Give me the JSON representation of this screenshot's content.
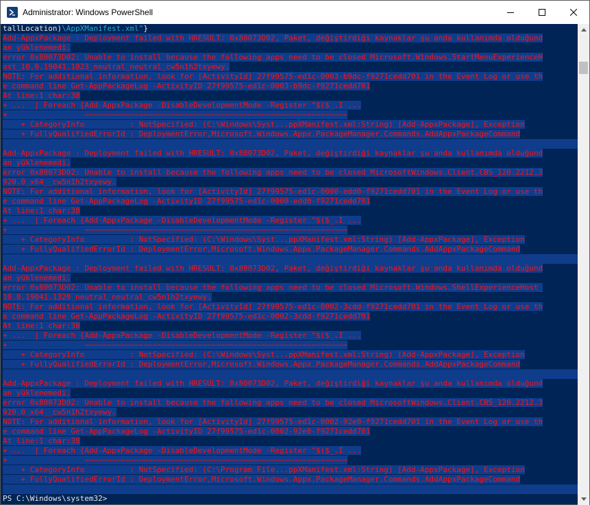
{
  "window": {
    "title": "Administrator: Windows PowerShell",
    "icon": "powershell-icon",
    "controls": [
      "minimize-icon",
      "maximize-icon",
      "close-icon"
    ]
  },
  "console": {
    "first_line": {
      "a": "tallLocation)",
      "b": "\\AppXManifest.xml\"",
      "c": "}"
    },
    "blocks": [
      {
        "lines": [
          "Add-AppxPackage : Deployment failed with HRESULT: 0x80073D02, Paket, değiştirdiği kaynaklar şu anda kullanımda olduğund",
          "an yüklenemedi.",
          "error 0x80073D02: Unable to install because the following apps need to be closed Microsoft.Windows.StartMenuExperienceH",
          "ost_10.0.19041.1023_neutral_neutral_cw5n1h2txyewy.",
          "NOTE: For additional information, look for [ActivityId] 27f99575-ed1c-0003-b9dc-f9271cedd701 in the Event Log or use th",
          "e command line Get-AppPackageLog -ActivityID 27f99575-ed1c-0003-b9dc-f9271cedd701",
          "At line:1 char:38",
          "+ ...  | Foreach {Add-AppxPackage -DisableDevelopmentMode -Register \"$($_.I ...",
          "+                 ~~~~~~~~~~~~~~~~~~~~~~~~~~~~~~~~~~~~~~~~~~~~~~~~~~~~~~~~~~",
          "    + CategoryInfo          : NotSpecified: (C:\\Windows\\Syst...ppXManifest.xml:String) [Add-AppxPackage], Exception",
          "    + FullyQualifiedErrorId : DeploymentError,Microsoft.Windows.Appx.PackageManager.Commands.AddAppxPackageCommand"
        ]
      },
      {
        "lines": [
          "Add-AppxPackage : Deployment failed with HRESULT: 0x80073D02, Paket, değiştirdiği kaynaklar şu anda kullanımda olduğund",
          "an yüklenemedi.",
          "error 0x80073D02: Unable to install because the following apps need to be closed MicrosoftWindows.Client.CBS_120.2212.3",
          "920.0_x64__cw5n1h2txyewy.",
          "NOTE: For additional information, look for [ActivityId] 27f99575-ed1c-0000-edd0-f9271cedd701 in the Event Log or use th",
          "e command line Get-AppPackageLog -ActivityID 27f99575-ed1c-0000-edd0-f9271cedd701",
          "At line:1 char:38",
          "+ ...  | Foreach {Add-AppxPackage -DisableDevelopmentMode -Register \"$($_.I ...",
          "+                 ~~~~~~~~~~~~~~~~~~~~~~~~~~~~~~~~~~~~~~~~~~~~~~~~~~~~~~~~~~",
          "    + CategoryInfo          : NotSpecified: (C:\\Windows\\Syst...ppXManifest.xml:String) [Add-AppxPackage], Exception",
          "    + FullyQualifiedErrorId : DeploymentError,Microsoft.Windows.Appx.PackageManager.Commands.AddAppxPackageCommand"
        ]
      },
      {
        "lines": [
          "Add-AppxPackage : Deployment failed with HRESULT: 0x80073D02, Paket, değiştirdiği kaynaklar şu anda kullanımda olduğund",
          "an yüklenemedi.",
          "error 0x80073D02: Unable to install because the following apps need to be closed Microsoft.Windows.ShellExperienceHost_",
          "10.0.19041.1320_neutral_neutral_cw5n1h2txyewy.",
          "NOTE: For additional information, look for [ActivityId] 27f99575-ed1c-0002-3cdd-f9271cedd701 in the Event Log or use th",
          "e command line Get-AppPackageLog -ActivityID 27f99575-ed1c-0002-3cdd-f9271cedd701",
          "At line:1 char:38",
          "+ ...  | Foreach {Add-AppxPackage -DisableDevelopmentMode -Register \"$($_.I ...",
          "+                 ~~~~~~~~~~~~~~~~~~~~~~~~~~~~~~~~~~~~~~~~~~~~~~~~~~~~~~~~~~",
          "    + CategoryInfo          : NotSpecified: (C:\\Windows\\Syst...ppXManifest.xml:String) [Add-AppxPackage], Exception",
          "    + FullyQualifiedErrorId : DeploymentError,Microsoft.Windows.Appx.PackageManager.Commands.AddAppxPackageCommand"
        ]
      },
      {
        "lines": [
          "Add-AppxPackage : Deployment failed with HRESULT: 0x80073D02, Paket, değiştirdiği kaynaklar şu anda kullanımda olduğund",
          "an yüklenemedi.",
          "error 0x80073D02: Unable to install because the following apps need to be closed MicrosoftWindows.Client.CBS_120.2212.3",
          "920.0_x64__cw5n1h2txyewy.",
          "NOTE: For additional information, look for [ActivityId] 27f99575-ed1c-0002-92e0-f9271cedd701 in the Event Log or use th",
          "e command line Get-AppPackageLog -ActivityID 27f99575-ed1c-0002-92e0-f9271cedd701",
          "At line:1 char:38",
          "+ ...  | Foreach {Add-AppxPackage -DisableDevelopmentMode -Register \"$($_.I ...",
          "+                 ~~~~~~~~~~~~~~~~~~~~~~~~~~~~~~~~~~~~~~~~~~~~~~~~~~~~~~~~~~",
          "    + CategoryInfo          : NotSpecified: (C:\\Program File...ppXManifest.xml:String) [Add-AppxPackage], Exception",
          "    + FullyQualifiedErrorId : DeploymentError,Microsoft.Windows.Appx.PackageManager.Commands.AddAppxPackageCommand"
        ]
      }
    ],
    "prompt": "PS C:\\Windows\\system32>"
  },
  "colors": {
    "background": "#012456",
    "error_text": "#ff1111",
    "error_highlight": "#0f3d8c",
    "default_text": "#e8e8e8",
    "string_text": "#2aa9d4"
  }
}
